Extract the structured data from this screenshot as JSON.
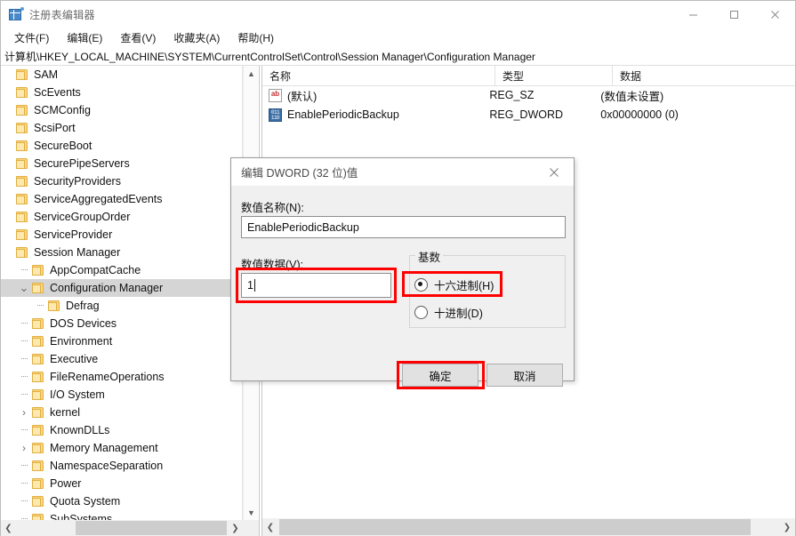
{
  "window": {
    "title": "注册表编辑器",
    "icon": "registry-editor-icon",
    "controls": {
      "minimize": "minimize-icon",
      "maximize": "maximize-icon",
      "close": "close-icon"
    }
  },
  "menubar": {
    "items": [
      {
        "label": "文件(F)"
      },
      {
        "label": "编辑(E)"
      },
      {
        "label": "查看(V)"
      },
      {
        "label": "收藏夹(A)"
      },
      {
        "label": "帮助(H)"
      }
    ]
  },
  "address": {
    "path": "计算机\\HKEY_LOCAL_MACHINE\\SYSTEM\\CurrentControlSet\\Control\\Session Manager\\Configuration Manager"
  },
  "tree": {
    "items": [
      {
        "label": "SAM",
        "indent": 0,
        "twisty": "none",
        "selected": false
      },
      {
        "label": "ScEvents",
        "indent": 0,
        "twisty": "none",
        "selected": false
      },
      {
        "label": "SCMConfig",
        "indent": 0,
        "twisty": "none",
        "selected": false
      },
      {
        "label": "ScsiPort",
        "indent": 0,
        "twisty": "none",
        "selected": false
      },
      {
        "label": "SecureBoot",
        "indent": 0,
        "twisty": "none",
        "selected": false
      },
      {
        "label": "SecurePipeServers",
        "indent": 0,
        "twisty": "none",
        "selected": false
      },
      {
        "label": "SecurityProviders",
        "indent": 0,
        "twisty": "none",
        "selected": false
      },
      {
        "label": "ServiceAggregatedEvents",
        "indent": 0,
        "twisty": "none",
        "selected": false
      },
      {
        "label": "ServiceGroupOrder",
        "indent": 0,
        "twisty": "none",
        "selected": false
      },
      {
        "label": "ServiceProvider",
        "indent": 0,
        "twisty": "none",
        "selected": false
      },
      {
        "label": "Session Manager",
        "indent": 0,
        "twisty": "none",
        "selected": false
      },
      {
        "label": "AppCompatCache",
        "indent": 1,
        "twisty": "dot",
        "selected": false
      },
      {
        "label": "Configuration Manager",
        "indent": 1,
        "twisty": "down",
        "selected": true
      },
      {
        "label": "Defrag",
        "indent": 2,
        "twisty": "dot",
        "selected": false
      },
      {
        "label": "DOS Devices",
        "indent": 1,
        "twisty": "dot",
        "selected": false
      },
      {
        "label": "Environment",
        "indent": 1,
        "twisty": "dot",
        "selected": false
      },
      {
        "label": "Executive",
        "indent": 1,
        "twisty": "dot",
        "selected": false
      },
      {
        "label": "FileRenameOperations",
        "indent": 1,
        "twisty": "dot",
        "selected": false
      },
      {
        "label": "I/O System",
        "indent": 1,
        "twisty": "dot",
        "selected": false
      },
      {
        "label": "kernel",
        "indent": 1,
        "twisty": "right",
        "selected": false
      },
      {
        "label": "KnownDLLs",
        "indent": 1,
        "twisty": "dot",
        "selected": false
      },
      {
        "label": "Memory Management",
        "indent": 1,
        "twisty": "right",
        "selected": false
      },
      {
        "label": "NamespaceSeparation",
        "indent": 1,
        "twisty": "dot",
        "selected": false
      },
      {
        "label": "Power",
        "indent": 1,
        "twisty": "dot",
        "selected": false
      },
      {
        "label": "Quota System",
        "indent": 1,
        "twisty": "dot",
        "selected": false
      },
      {
        "label": "SubSystems",
        "indent": 1,
        "twisty": "dot",
        "selected": false
      }
    ]
  },
  "list": {
    "columns": [
      {
        "label": "名称"
      },
      {
        "label": "类型"
      },
      {
        "label": "数据"
      }
    ],
    "rows": [
      {
        "icon": "string-value-icon",
        "name": "(默认)",
        "type": "REG_SZ",
        "data": "(数值未设置)"
      },
      {
        "icon": "dword-value-icon",
        "name": "EnablePeriodicBackup",
        "type": "REG_DWORD",
        "data": "0x00000000 (0)"
      }
    ]
  },
  "dialog": {
    "title": "编辑 DWORD (32 位)值",
    "close_icon": "close-icon",
    "value_name_label": "数值名称(N):",
    "value_name": "EnablePeriodicBackup",
    "value_data_label": "数值数据(V):",
    "value_data": "1",
    "radix": {
      "legend": "基数",
      "options": [
        {
          "label": "十六进制(H)",
          "selected": true
        },
        {
          "label": "十进制(D)",
          "selected": false
        }
      ]
    },
    "ok_label": "确定",
    "cancel_label": "取消"
  },
  "annotations": {
    "color": "#ff0000",
    "boxes": [
      "value-data-field",
      "hex-radio-option",
      "ok-button"
    ]
  }
}
